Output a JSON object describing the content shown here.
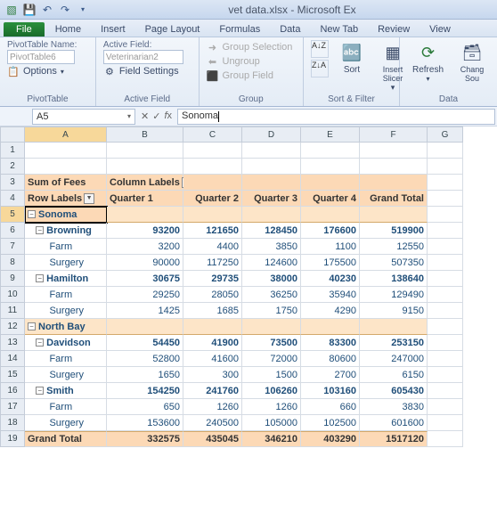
{
  "app": {
    "title": "vet data.xlsx - Microsoft Ex"
  },
  "qat": {
    "save": "💾",
    "undo": "↶",
    "redo": "↷"
  },
  "tabs": {
    "file": "File",
    "items": [
      "Home",
      "Insert",
      "Page Layout",
      "Formulas",
      "Data",
      "New Tab",
      "Review",
      "View"
    ]
  },
  "ribbon": {
    "pt_name_label": "PivotTable Name:",
    "pt_name_value": "PivotTable6",
    "options_label": "Options",
    "group_pt": "PivotTable",
    "af_label": "Active Field:",
    "af_value": "Veterinarian2",
    "field_settings": "Field Settings",
    "group_af": "Active Field",
    "group_sel": "Group Selection",
    "ungroup": "Ungroup",
    "group_field": "Group Field",
    "group_grp": "Group",
    "sort": "Sort",
    "insert_slicer": "Insert\nSlicer",
    "group_sf": "Sort & Filter",
    "refresh": "Refresh",
    "change_src": "Chang\nSou",
    "group_data": "Data"
  },
  "namebox": {
    "ref": "A5",
    "formula": "Sonoma"
  },
  "cols": [
    "A",
    "B",
    "C",
    "D",
    "E",
    "F",
    "G"
  ],
  "pivot": {
    "sum_label": "Sum of Fees",
    "col_label": "Column Labels",
    "row_label": "Row Labels",
    "quarters": [
      "Quarter 1",
      "Quarter 2",
      "Quarter 3",
      "Quarter 4",
      "Grand Total"
    ],
    "regions": [
      {
        "name": "Sonoma",
        "subs": [
          {
            "name": "Browning",
            "vals": [
              93200,
              121650,
              128450,
              176600,
              519900
            ],
            "cats": [
              {
                "name": "Farm",
                "vals": [
                  3200,
                  4400,
                  3850,
                  1100,
                  12550
                ]
              },
              {
                "name": "Surgery",
                "vals": [
                  90000,
                  117250,
                  124600,
                  175500,
                  507350
                ]
              }
            ]
          },
          {
            "name": "Hamilton",
            "vals": [
              30675,
              29735,
              38000,
              40230,
              138640
            ],
            "cats": [
              {
                "name": "Farm",
                "vals": [
                  29250,
                  28050,
                  36250,
                  35940,
                  129490
                ]
              },
              {
                "name": "Surgery",
                "vals": [
                  1425,
                  1685,
                  1750,
                  4290,
                  9150
                ]
              }
            ]
          }
        ]
      },
      {
        "name": "North Bay",
        "subs": [
          {
            "name": "Davidson",
            "vals": [
              54450,
              41900,
              73500,
              83300,
              253150
            ],
            "cats": [
              {
                "name": "Farm",
                "vals": [
                  52800,
                  41600,
                  72000,
                  80600,
                  247000
                ]
              },
              {
                "name": "Surgery",
                "vals": [
                  1650,
                  300,
                  1500,
                  2700,
                  6150
                ]
              }
            ]
          },
          {
            "name": "Smith",
            "vals": [
              154250,
              241760,
              106260,
              103160,
              605430
            ],
            "cats": [
              {
                "name": "Farm",
                "vals": [
                  650,
                  1260,
                  1260,
                  660,
                  3830
                ]
              },
              {
                "name": "Surgery",
                "vals": [
                  153600,
                  240500,
                  105000,
                  102500,
                  601600
                ]
              }
            ]
          }
        ]
      }
    ],
    "grand_label": "Grand Total",
    "grand": [
      332575,
      435045,
      346210,
      403290,
      1517120
    ]
  }
}
